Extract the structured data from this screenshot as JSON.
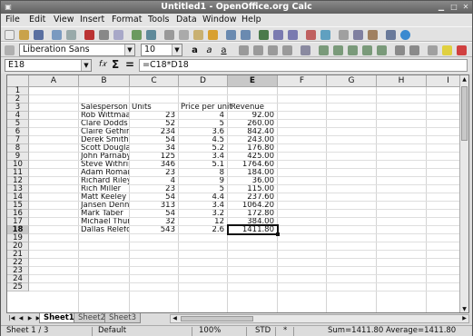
{
  "window": {
    "title": "Untitled1 - OpenOffice.org Calc"
  },
  "menu": [
    "File",
    "Edit",
    "View",
    "Insert",
    "Format",
    "Tools",
    "Data",
    "Window",
    "Help"
  ],
  "format_toolbar": {
    "font_name": "Liberation Sans",
    "font_size": "10"
  },
  "formula_bar": {
    "cell_ref": "E18",
    "formula": "=C18*D18"
  },
  "columns": [
    "A",
    "B",
    "C",
    "D",
    "E",
    "F",
    "G",
    "H",
    "I"
  ],
  "rows": [
    "1",
    "2",
    "3",
    "4",
    "5",
    "6",
    "7",
    "8",
    "9",
    "10",
    "11",
    "12",
    "13",
    "14",
    "15",
    "16",
    "17",
    "18",
    "19",
    "20",
    "21",
    "22",
    "23",
    "24",
    "25"
  ],
  "header_row": {
    "salesperson": "Salesperson",
    "units": "Units",
    "price": "Price per unit",
    "revenue": "Revenue"
  },
  "data_rows": [
    {
      "name": "Rob Wittmaa",
      "units": "23",
      "price": "4",
      "revenue": "92.00"
    },
    {
      "name": "Clare Dodds",
      "units": "52",
      "price": "5",
      "revenue": "260.00"
    },
    {
      "name": "Claire Gethin",
      "units": "234",
      "price": "3.6",
      "revenue": "842.40"
    },
    {
      "name": "Derek Smith",
      "units": "54",
      "price": "4.5",
      "revenue": "243.00"
    },
    {
      "name": "Scott Douglas",
      "units": "34",
      "price": "5.2",
      "revenue": "176.80"
    },
    {
      "name": "John Parnaby",
      "units": "125",
      "price": "3.4",
      "revenue": "425.00"
    },
    {
      "name": "Steve Withring",
      "units": "346",
      "price": "5.1",
      "revenue": "1764.60"
    },
    {
      "name": "Adam Romain",
      "units": "23",
      "price": "8",
      "revenue": "184.00"
    },
    {
      "name": "Richard Riley",
      "units": "4",
      "price": "9",
      "revenue": "36.00"
    },
    {
      "name": "Rich Miller",
      "units": "23",
      "price": "5",
      "revenue": "115.00"
    },
    {
      "name": "Matt Keeley",
      "units": "54",
      "price": "4.4",
      "revenue": "237.60"
    },
    {
      "name": "Jansen Denne",
      "units": "313",
      "price": "3.4",
      "revenue": "1064.20"
    },
    {
      "name": "Mark Taber",
      "units": "54",
      "price": "3.2",
      "revenue": "172.80"
    },
    {
      "name": "Michael Thurs",
      "units": "32",
      "price": "12",
      "revenue": "384.00"
    },
    {
      "name": "Dallas Relefor",
      "units": "543",
      "price": "2.6",
      "revenue": "1411.80"
    }
  ],
  "sheet_tabs": [
    "Sheet1",
    "Sheet2",
    "Sheet3"
  ],
  "status": {
    "sheet": "Sheet 1 / 3",
    "style": "Default",
    "zoom": "100%",
    "mode": "STD",
    "modified": "*",
    "sum": "Sum=1411.80 Average=1411.80"
  }
}
